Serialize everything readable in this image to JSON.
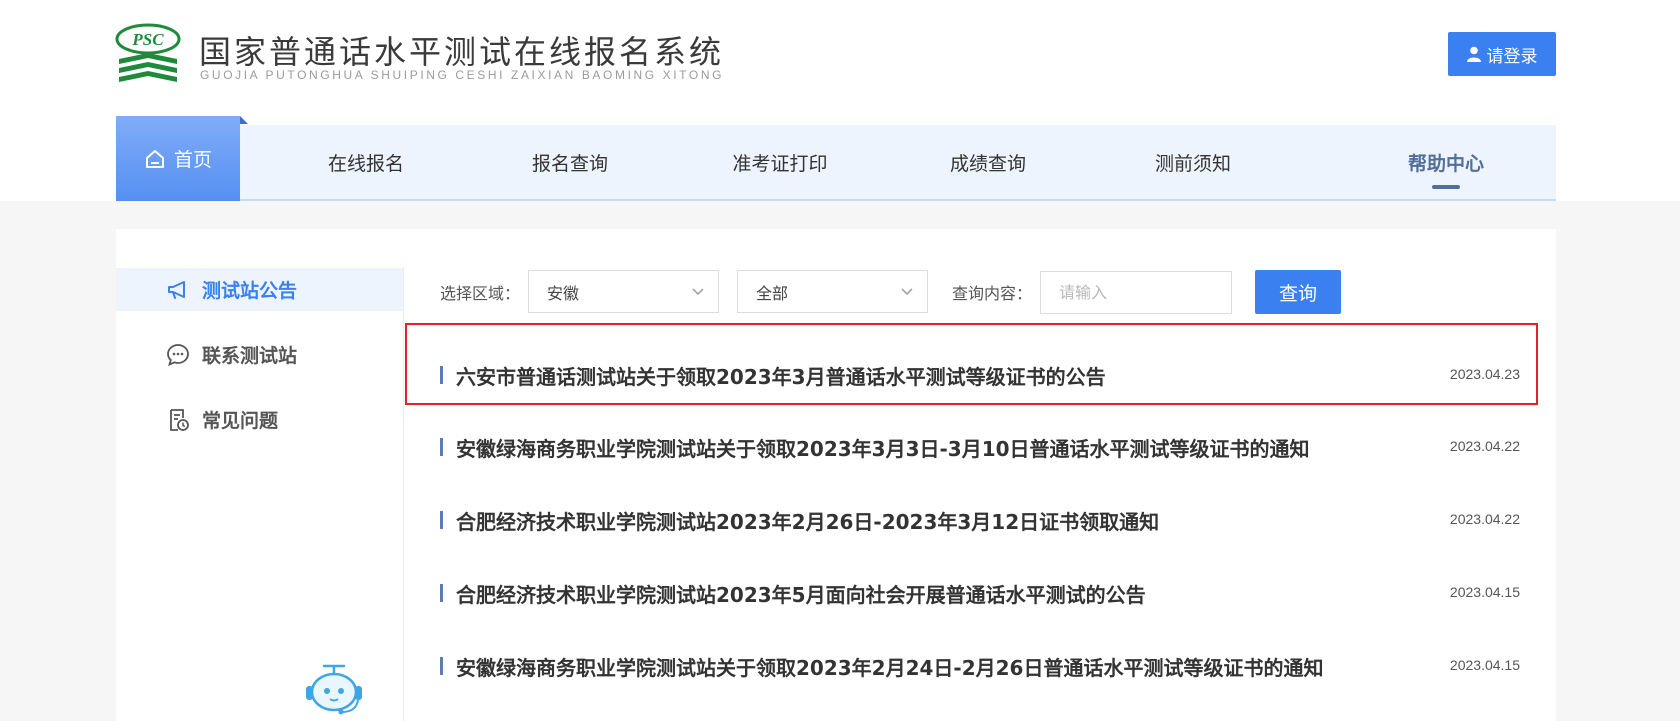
{
  "header": {
    "title": "国家普通话水平测试在线报名系统",
    "subtitle": "GUOJIA PUTONGHUA SHUIPING CESHI ZAIXIAN BAOMING XITONG",
    "logo_text": "PSC",
    "login_label": "请登录"
  },
  "nav": {
    "items": [
      {
        "label": "首页"
      },
      {
        "label": "在线报名"
      },
      {
        "label": "报名查询"
      },
      {
        "label": "准考证打印"
      },
      {
        "label": "成绩查询"
      },
      {
        "label": "测前须知"
      },
      {
        "label": "帮助中心"
      }
    ],
    "active": "帮助中心"
  },
  "sidebar": {
    "items": [
      {
        "label": "测试站公告",
        "icon": "megaphone-icon",
        "active": true
      },
      {
        "label": "联系测试站",
        "icon": "chat-icon"
      },
      {
        "label": "常见问题",
        "icon": "faq-document-icon"
      }
    ]
  },
  "filters": {
    "region_label": "选择区域：",
    "province": "安徽",
    "scope": "全部",
    "query_label": "查询内容：",
    "query_placeholder": "请输入",
    "query_button": "查询"
  },
  "notices": [
    {
      "title": "六安市普通话测试站关于领取2023年3月普通话水平测试等级证书的公告",
      "date": "2023.04.23",
      "highlighted": true
    },
    {
      "title": "安徽绿海商务职业学院测试站关于领取2023年3月3日-3月10日普通话水平测试等级证书的通知",
      "date": "2023.04.22"
    },
    {
      "title": "合肥经济技术职业学院测试站2023年2月26日-2023年3月12日证书领取通知",
      "date": "2023.04.22"
    },
    {
      "title": "合肥经济技术职业学院测试站2023年5月面向社会开展普通话水平测试的公告",
      "date": "2023.04.15"
    },
    {
      "title": "安徽绿海商务职业学院测试站关于领取2023年2月24日-2月26日普通话水平测试等级证书的通知",
      "date": "2023.04.15"
    }
  ],
  "colors": {
    "accent": "#3b80f0",
    "nav_bg": "#eef4fd",
    "active_nav": "#526f9b",
    "logo_green": "#1f8a3b",
    "highlight": "#e4202a"
  }
}
